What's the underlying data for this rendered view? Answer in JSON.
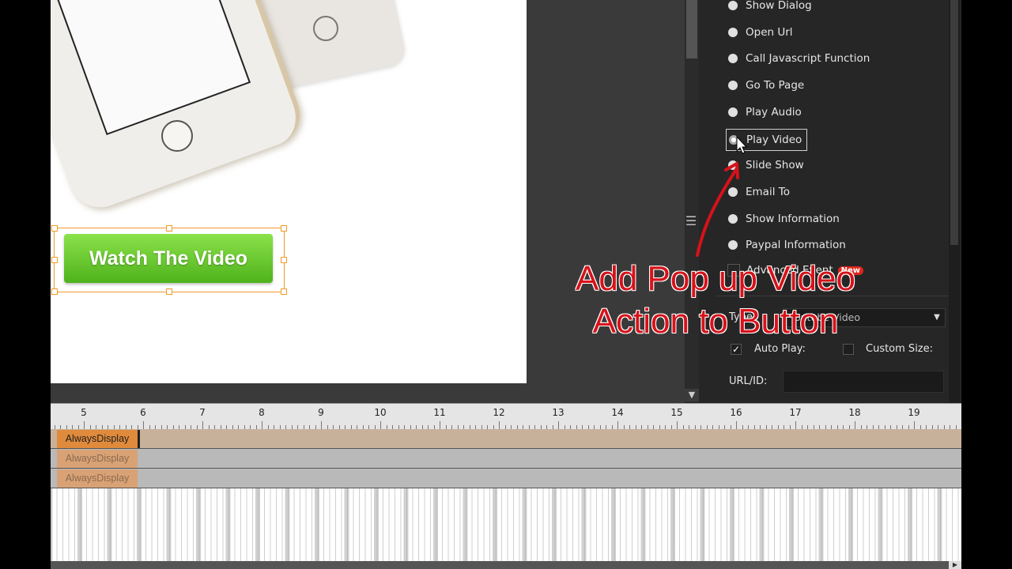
{
  "stage": {
    "button_label": "Watch The Video"
  },
  "actions": {
    "items": [
      {
        "label": "Show Dialog",
        "selected": false
      },
      {
        "label": "Open Url",
        "selected": false
      },
      {
        "label": "Call Javascript Function",
        "selected": false
      },
      {
        "label": "Go To Page",
        "selected": false
      },
      {
        "label": "Play Audio",
        "selected": false
      },
      {
        "label": "Play Video",
        "selected": true
      },
      {
        "label": "Slide Show",
        "selected": false
      },
      {
        "label": "Email To",
        "selected": false
      },
      {
        "label": "Show Information",
        "selected": false
      },
      {
        "label": "Paypal Information",
        "selected": false
      }
    ],
    "advanced_label": "Advanced Event",
    "new_badge": "New"
  },
  "video_options": {
    "type_label": "Type:",
    "type_value": "Youtube Video",
    "autoplay_label": "Auto Play:",
    "autoplay_checked": true,
    "custom_size_label": "Custom Size:",
    "custom_size_checked": false,
    "url_label": "URL/ID:",
    "url_value": ""
  },
  "annotation": {
    "line1": "Add Pop up Video",
    "line2": "Action to Button",
    "color": "#d6121a"
  },
  "timeline": {
    "ruler_labels": [
      "5",
      "6",
      "7",
      "8",
      "9",
      "10",
      "11",
      "12",
      "13",
      "14",
      "15",
      "16",
      "17",
      "18",
      "19"
    ],
    "clips": [
      {
        "label": "AlwaysDisplay"
      },
      {
        "label": "AlwaysDisplay"
      },
      {
        "label": "AlwaysDisplay"
      }
    ]
  },
  "icons": {
    "splitter": "grip-icon",
    "scroll_down": "triangle-down-icon",
    "dropdown": "triangle-down-icon",
    "checkmark": "check-icon",
    "cursor": "mouse-pointer-icon"
  }
}
